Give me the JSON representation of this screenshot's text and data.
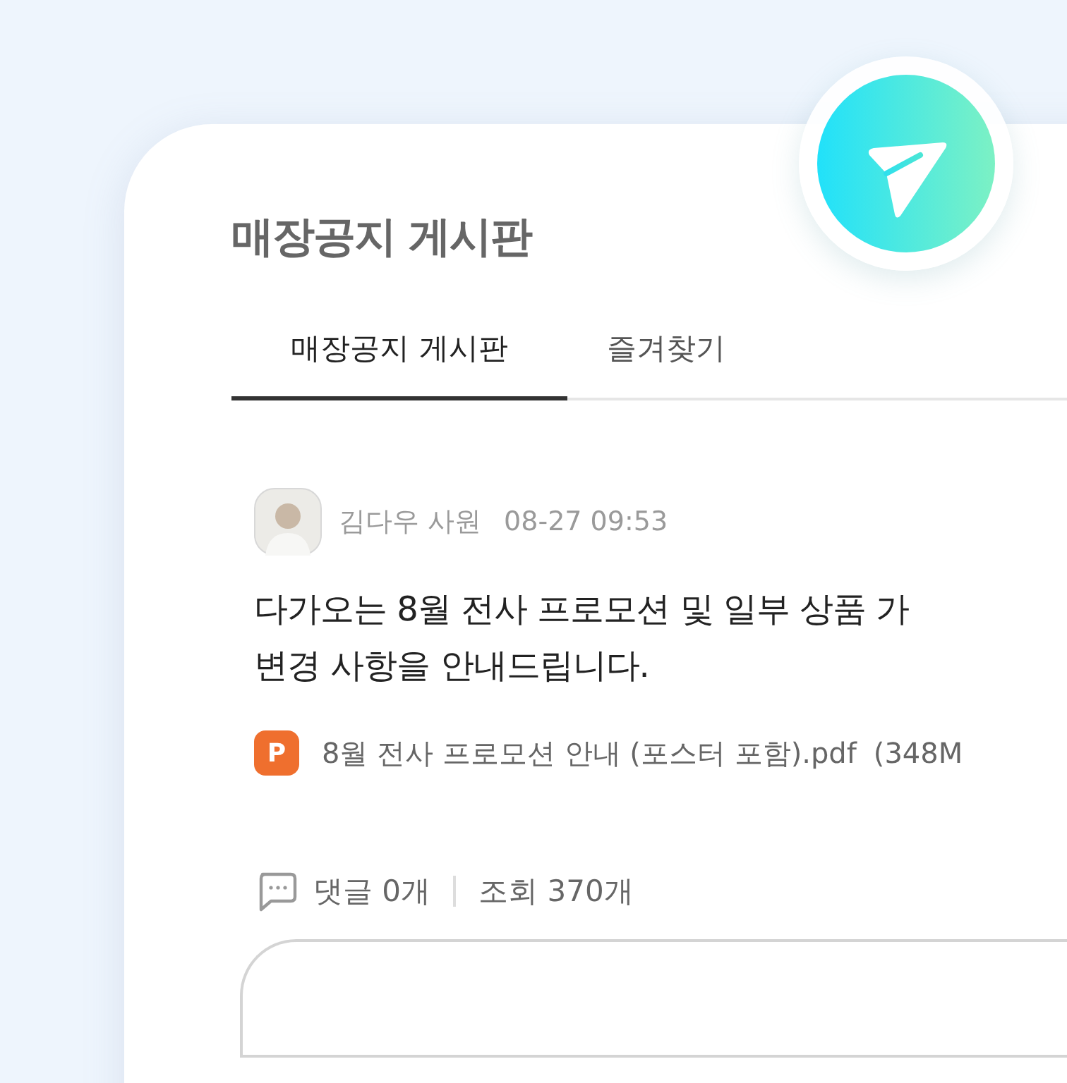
{
  "board": {
    "title": "매장공지 게시판"
  },
  "tabs": [
    {
      "label": "매장공지 게시판",
      "selected": true
    },
    {
      "label": "즐겨찾기",
      "selected": false
    }
  ],
  "post": {
    "author": "김다우 사원",
    "time": "08-27 09:53",
    "body_lines": [
      "다가오는 8월 전사 프로모션 및 일부 상품 가",
      "변경 사항을 안내드립니다."
    ],
    "attachment": {
      "badge": "P",
      "name": "8월 전사 프로모션 안내 (포스터 포함).pdf",
      "size": "(348M"
    },
    "comments": "댓글 0개",
    "views": "조회 370개"
  }
}
